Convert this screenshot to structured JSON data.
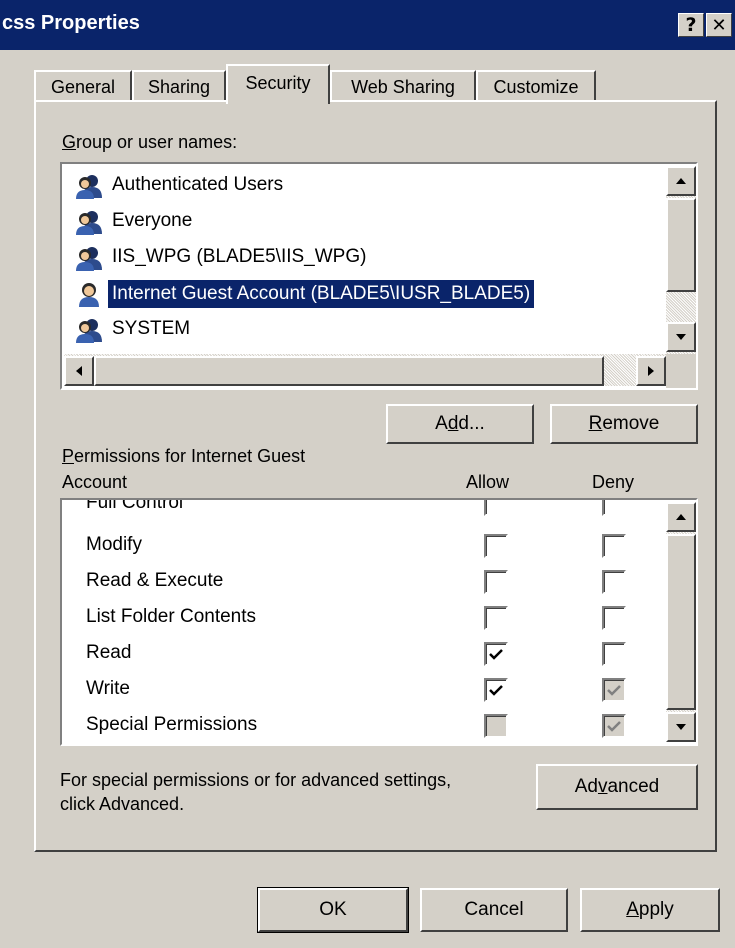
{
  "window": {
    "title": "css Properties",
    "help_label": "?",
    "close_label": "✕"
  },
  "tabs": [
    {
      "label": "General",
      "active": false
    },
    {
      "label": "Sharing",
      "active": false
    },
    {
      "label": "Security",
      "active": true
    },
    {
      "label": "Web Sharing",
      "active": false
    },
    {
      "label": "Customize",
      "active": false
    }
  ],
  "groups": {
    "label_prefix": "G",
    "label_rest": "roup or user names:",
    "items": [
      {
        "name": "Authenticated Users",
        "icon": "group-users-icon",
        "selected": false
      },
      {
        "name": "Everyone",
        "icon": "group-users-icon",
        "selected": false
      },
      {
        "name": "IIS_WPG (BLADE5\\IIS_WPG)",
        "icon": "group-users-icon",
        "selected": false
      },
      {
        "name": "Internet Guest Account (BLADE5\\IUSR_BLADE5)",
        "icon": "single-user-icon",
        "selected": true
      },
      {
        "name": "SYSTEM",
        "icon": "group-users-icon",
        "selected": false
      }
    ]
  },
  "buttons": {
    "add_pre": "A",
    "add_u": "d",
    "add_post": "d...",
    "remove_u": "R",
    "remove_post": "emove",
    "advanced_pre": "Ad",
    "advanced_u": "v",
    "advanced_post": "anced",
    "ok": "OK",
    "cancel": "Cancel",
    "apply_u": "A",
    "apply_post": "pply"
  },
  "permissions": {
    "label_u": "P",
    "label_line1_rest": "ermissions for Internet Guest",
    "label_line2": "Account",
    "allow_header": "Allow",
    "deny_header": "Deny",
    "rows": [
      {
        "name": "Full Control",
        "allow": false,
        "allow_disabled": false,
        "deny": false,
        "deny_disabled": false
      },
      {
        "name": "Modify",
        "allow": false,
        "allow_disabled": false,
        "deny": false,
        "deny_disabled": false
      },
      {
        "name": "Read & Execute",
        "allow": false,
        "allow_disabled": false,
        "deny": false,
        "deny_disabled": false
      },
      {
        "name": "List Folder Contents",
        "allow": false,
        "allow_disabled": false,
        "deny": false,
        "deny_disabled": false
      },
      {
        "name": "Read",
        "allow": true,
        "allow_disabled": false,
        "deny": false,
        "deny_disabled": false
      },
      {
        "name": "Write",
        "allow": true,
        "allow_disabled": false,
        "deny": true,
        "deny_disabled": true
      },
      {
        "name": "Special Permissions",
        "allow": false,
        "allow_disabled": true,
        "deny": true,
        "deny_disabled": true
      }
    ]
  },
  "advanced_note": {
    "line1": "For special permissions or for advanced settings,",
    "line2": "click Advanced."
  }
}
